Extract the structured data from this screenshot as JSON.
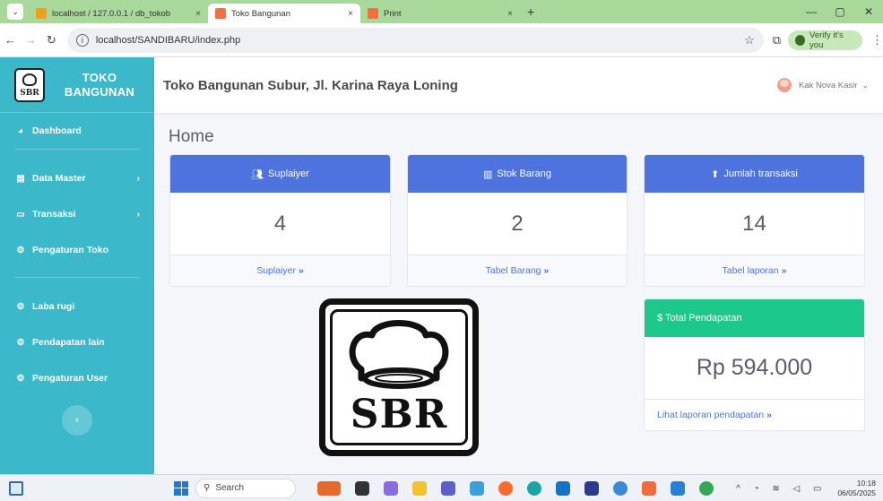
{
  "browser": {
    "tabs": [
      {
        "label": "localhost / 127.0.0.1 / db_tokob",
        "favicon_color": "#f0a020",
        "active": false
      },
      {
        "label": "Toko Bangunan",
        "favicon_color": "#f07040",
        "active": true
      },
      {
        "label": "Print",
        "favicon_color": "#f07040",
        "active": false
      }
    ],
    "tab_close": "×",
    "new_tab": "+",
    "minimize": "—",
    "restore": "▢",
    "close": "✕",
    "url": "localhost/SANDIBARU/index.php",
    "profile_label": "Verify it's you"
  },
  "sidebar": {
    "brand_line1": "TOKO",
    "brand_line2": "BANGUNAN",
    "brand_logo_text": "SBR",
    "items": [
      {
        "label": "Dashboard",
        "icon": "dashboard-icon",
        "has_chevron": false
      },
      {
        "label": "Data Master",
        "icon": "database-icon",
        "has_chevron": true
      },
      {
        "label": "Transaksi",
        "icon": "desktop-icon",
        "has_chevron": true
      },
      {
        "label": "Pengaturan Toko",
        "icon": "cogs-icon",
        "has_chevron": false
      },
      {
        "label": "Laba rugi",
        "icon": "cogs-icon",
        "has_chevron": false
      },
      {
        "label": "Pendapatan lain",
        "icon": "cogs-icon",
        "has_chevron": false
      },
      {
        "label": "Pengaturan User",
        "icon": "cogs-icon",
        "has_chevron": false
      }
    ]
  },
  "topbar": {
    "store_name": "Toko Bangunan Subur, Jl. Karina Raya Loning",
    "user_name": "Kak Nova Kasir"
  },
  "main": {
    "page_title": "Home",
    "cards": [
      {
        "title": "Suplaiyer",
        "icon": "users-icon",
        "value": "4",
        "link": "Suplaiyer"
      },
      {
        "title": "Stok Barang",
        "icon": "chart-icon",
        "value": "2",
        "link": "Tabel Barang"
      },
      {
        "title": "Jumlah transaksi",
        "icon": "upload-icon",
        "value": "14",
        "link": "Tabel laporan"
      }
    ],
    "total": {
      "title": "$ Total Pendapatan",
      "value": "Rp 594.000",
      "link": "Lihat laporan pendapatan"
    },
    "logo_text": "SBR"
  },
  "taskbar": {
    "search_placeholder": "Search",
    "time": "10:18",
    "date": "06/05/2025"
  },
  "colors": {
    "sidebar": "#3bb8c9",
    "card_header": "#4e73df",
    "total_header": "#1cc88a",
    "tabstrip": "#a8d89a"
  }
}
